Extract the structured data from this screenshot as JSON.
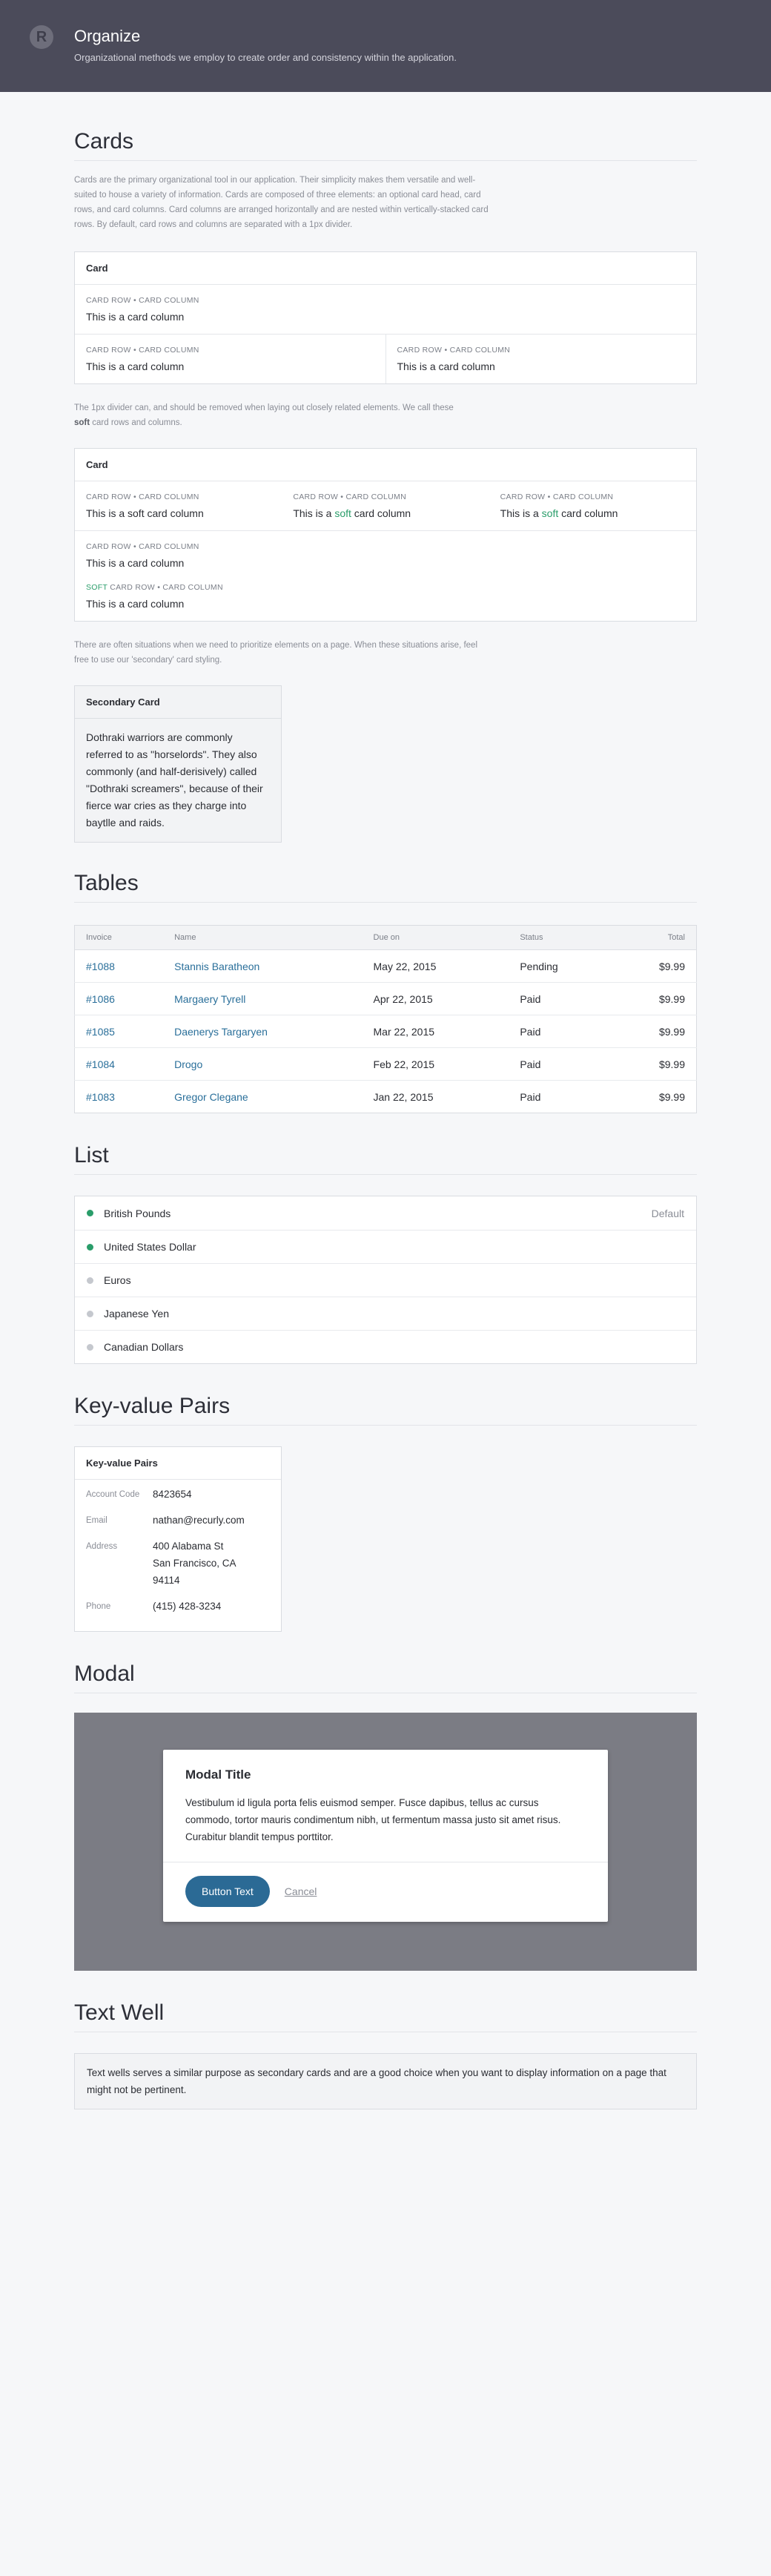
{
  "header": {
    "logo": "R",
    "title": "Organize",
    "subtitle": "Organizational methods we employ to create order and consistency within the application."
  },
  "cards_section": {
    "title": "Cards",
    "description": "Cards are the primary organizational tool in our application. Their simplicity makes them versatile and well-suited to house a variety of information. Cards are composed of three elements: an optional card head,  card rows, and card columns. Card columns are arranged horizontally and are nested within vertically-stacked card rows. By default, card rows and columns are separated with a 1px divider.",
    "card1": {
      "title": "Card",
      "label_row": "CARD ROW",
      "label_sep": "•",
      "label_col": "CARD COLUMN",
      "text": "This is a card column"
    },
    "desc2_a": "The 1px divider can, and should be removed when laying out closely related elements. We call these",
    "desc2_soft": "soft",
    "desc2_b": " card rows and columns.",
    "card2": {
      "title": "Card",
      "soft_word": "soft",
      "soft_label": "SOFT",
      "text_prefix": "This is a ",
      "text_suffix": " card column",
      "text_plain": "This is a card column"
    },
    "desc3": "There are often situations when we need to prioritize elements on a page. When these situations arise, feel free to use our 'secondary' card styling.",
    "secondary": {
      "title": "Secondary Card",
      "body": "Dothraki warriors are commonly referred to as \"horselords\". They also commonly (and half-derisively) called \"Dothraki screamers\", because of their fierce war cries as they charge into baytlle and raids."
    }
  },
  "tables_section": {
    "title": "Tables",
    "columns": [
      "Invoice",
      "Name",
      "Due on",
      "Status",
      "Total"
    ],
    "rows": [
      {
        "invoice": "#1088",
        "name": "Stannis Baratheon",
        "due": "May 22, 2015",
        "status": "Pending",
        "total": "$9.99"
      },
      {
        "invoice": "#1086",
        "name": "Margaery Tyrell",
        "due": "Apr 22, 2015",
        "status": "Paid",
        "total": "$9.99"
      },
      {
        "invoice": "#1085",
        "name": "Daenerys Targaryen",
        "due": "Mar 22, 2015",
        "status": "Paid",
        "total": "$9.99"
      },
      {
        "invoice": "#1084",
        "name": "Drogo",
        "due": "Feb 22, 2015",
        "status": "Paid",
        "total": "$9.99"
      },
      {
        "invoice": "#1083",
        "name": "Gregor Clegane",
        "due": "Jan 22, 2015",
        "status": "Paid",
        "total": "$9.99"
      }
    ]
  },
  "list_section": {
    "title": "List",
    "items": [
      {
        "label": "British Pounds",
        "tag": "Default",
        "active": true
      },
      {
        "label": "United States Dollar",
        "tag": "",
        "active": true
      },
      {
        "label": "Euros",
        "tag": "",
        "active": false
      },
      {
        "label": "Japanese Yen",
        "tag": "",
        "active": false
      },
      {
        "label": "Canadian Dollars",
        "tag": "",
        "active": false
      }
    ]
  },
  "kv_section": {
    "title": "Key-value Pairs",
    "card_title": "Key-value Pairs",
    "pairs": [
      {
        "key": "Account Code",
        "value": "8423654"
      },
      {
        "key": "Email",
        "value": "nathan@recurly.com"
      },
      {
        "key": "Address",
        "value": "400 Alabama St\nSan Francisco, CA\n94114"
      },
      {
        "key": "Phone",
        "value": "(415) 428-3234"
      }
    ]
  },
  "modal_section": {
    "title": "Modal",
    "modal_title": "Modal Title",
    "modal_body": "Vestibulum id ligula porta felis euismod semper. Fusce dapibus, tellus ac cursus commodo, tortor mauris condimentum nibh, ut fermentum massa justo sit amet risus. Curabitur blandit tempus porttitor.",
    "button_label": "Button Text",
    "cancel_label": "Cancel"
  },
  "well_section": {
    "title": "Text Well",
    "text": "Text wells serves a similar purpose as secondary cards and are a good choice when you want to display information on a page that might not be pertinent."
  },
  "colors": {
    "header_bg": "#4b4b5a",
    "link": "#2a6f9a",
    "soft_accent": "#2a9d6a",
    "primary_button": "#2b6a95"
  }
}
